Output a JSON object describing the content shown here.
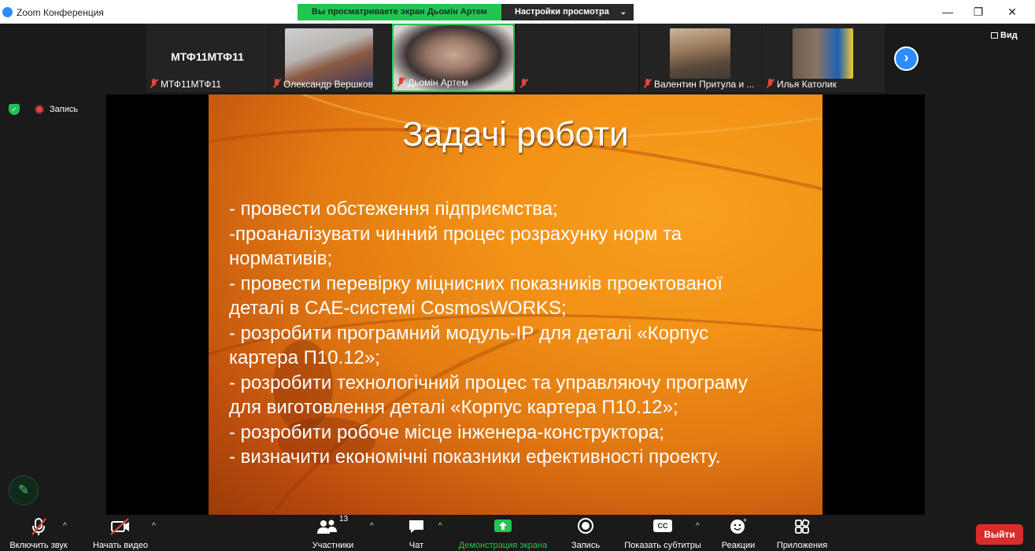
{
  "window": {
    "title": "Zoom Конференция",
    "share_banner": "Вы просматриваете экран Дьомін Артем",
    "view_options": "Настройки просмотра"
  },
  "participants": [
    {
      "tile_name": "МТФ11МТФ11",
      "label": "МТФ11МТФ11",
      "has_video": false
    },
    {
      "label": "Олександр Вершков",
      "has_video": true
    },
    {
      "label": "Дьомін Артем",
      "has_video": true,
      "active_speaker": true
    },
    {
      "label": "",
      "has_video": false
    },
    {
      "label": "Валентин Притула и ...",
      "has_video": true
    },
    {
      "label": "Илья Католик",
      "has_video": true
    }
  ],
  "view_button": "Вид",
  "recording_label": "Запись",
  "slide": {
    "title": "Задачі роботи",
    "lines": [
      "- провести обстеження підприємства;",
      "-проаналізувати чинний процес розрахунку  норм та",
      "нормативів;",
      "- провести перевірку міцнисних показників проектованої",
      "деталі в CAE-системі CosmosWORKS;",
      "- розробити програмний модуль-ІР для деталі «Корпус",
      "картера П10.12»;",
      "- розробити технологічний процес та управляючу програму",
      "для виготовлення деталі «Корпус картера П10.12»;",
      "- розробити робоче місце інженера-конструктора;",
      "- визначити економічні показники ефективності проекту."
    ]
  },
  "toolbar": {
    "audio": "Включить звук",
    "video": "Начать видео",
    "participants": "Участники",
    "participants_count": "13",
    "chat": "Чат",
    "share": "Демонстрация экрана",
    "record": "Запись",
    "captions": "Показать субтитры",
    "captions_icon_text": "CC",
    "reactions": "Реакции",
    "apps": "Приложения",
    "exit": "Выйти"
  },
  "colors": {
    "zoom_blue": "#2d8cff",
    "share_green": "#23c552",
    "mute_red": "#e0443e",
    "exit_red": "#d92d2a",
    "slide_orange": "#f29216"
  },
  "icons": [
    "zoom-logo-icon",
    "minimize-icon",
    "restore-icon",
    "close-icon",
    "mic-off-icon",
    "video-off-icon",
    "participants-icon",
    "chat-icon",
    "share-screen-icon",
    "record-icon",
    "captions-icon",
    "reactions-icon",
    "apps-icon",
    "annotate-pen-icon",
    "security-shield-icon",
    "next-page-icon"
  ]
}
